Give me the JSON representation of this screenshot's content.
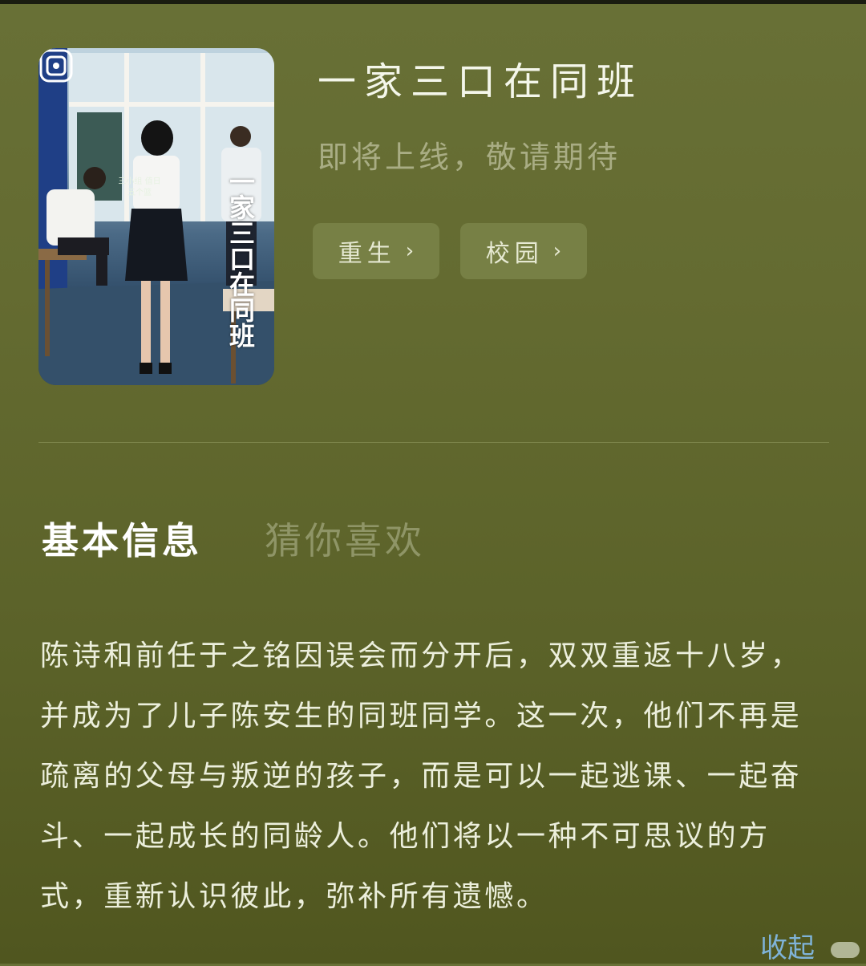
{
  "book": {
    "title": "一家三口在同班",
    "subtitle": "即将上线，敬请期待",
    "cover": {
      "vertical_title": "一家三口在同班",
      "board_text": "三小组 值日 五个篮"
    }
  },
  "tags": [
    {
      "label": "重生",
      "chevron": "›"
    },
    {
      "label": "校园",
      "chevron": "›"
    }
  ],
  "tabs": {
    "info": "基本信息",
    "guess": "猜你喜欢"
  },
  "synopsis": "陈诗和前任于之铭因误会而分开后，双双重返十八岁，并成为了儿子陈安生的同班同学。这一次，他们不再是疏离的父母与叛逆的孩子，而是可以一起逃课、一起奋斗、一起成长的同龄人。他们将以一种不可思议的方式，重新认识彼此，弥补所有遗憾。",
  "collapse_label": "收起",
  "colors": {
    "background": "#646b31",
    "title": "#f4f6ea",
    "subtitle": "#a9ad84",
    "tag_bg": "#87915a",
    "link": "#7fb3d8"
  }
}
